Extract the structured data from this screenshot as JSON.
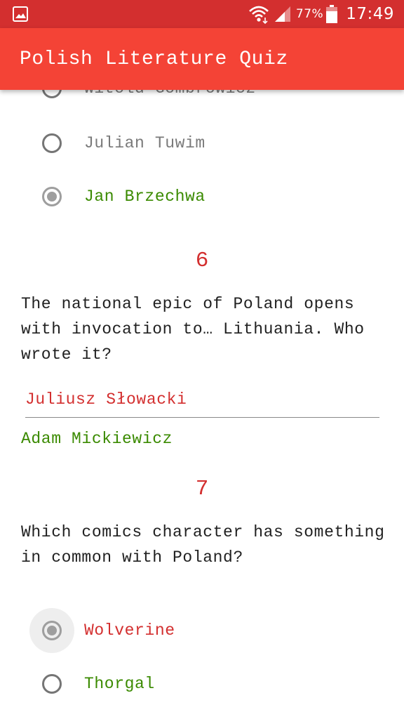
{
  "status_bar": {
    "battery_percent": "77%",
    "time": "17:49",
    "icons": [
      "image-notification-icon",
      "wifi-icon",
      "cell-signal-icon",
      "battery-icon"
    ]
  },
  "app_bar": {
    "title": "Polish Literature Quiz"
  },
  "question5": {
    "options": [
      {
        "label": "Witold Gombrowicz",
        "checked": false,
        "result": "neutral"
      },
      {
        "label": "Julian Tuwim",
        "checked": false,
        "result": "neutral"
      },
      {
        "label": "Jan Brzechwa",
        "checked": true,
        "result": "correct"
      }
    ]
  },
  "question6": {
    "number": "6",
    "text": "The national epic of Poland opens with invocation to… Lithuania. Who wrote it?",
    "user_answer": "Juliusz Słowacki",
    "correct_answer": "Adam Mickiewicz"
  },
  "question7": {
    "number": "7",
    "text": "Which comics character has something in common with Poland?",
    "options": [
      {
        "label": "Wolverine",
        "checked": true,
        "result": "wrong"
      },
      {
        "label": "Thorgal",
        "checked": false,
        "result": "correct"
      }
    ]
  },
  "colors": {
    "status_bar": "#d32f2f",
    "app_bar": "#f44336",
    "correct": "#3a8a00",
    "wrong": "#d32f2f",
    "neutral_text": "#7a7a7a",
    "question_number": "#d32f2f"
  }
}
